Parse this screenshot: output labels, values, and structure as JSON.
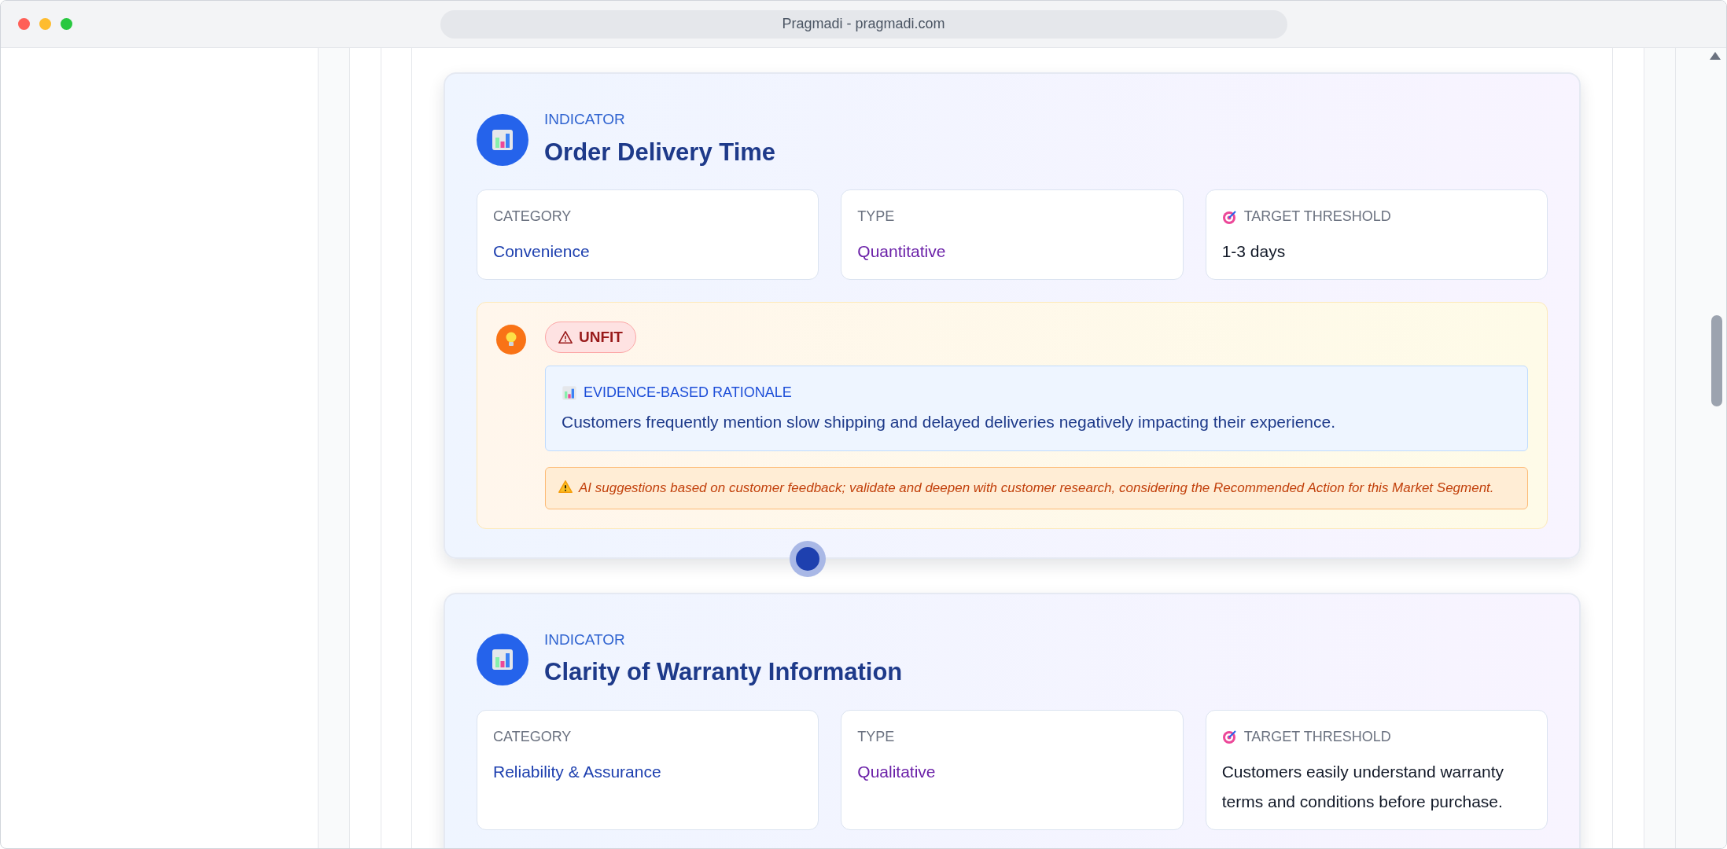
{
  "window": {
    "title": "Pragmadi - pragmadi.com"
  },
  "indicators": [
    {
      "eyebrow": "INDICATOR",
      "title": "Order Delivery Time",
      "fields": [
        {
          "kind": "category",
          "label": "CATEGORY",
          "value": "Convenience"
        },
        {
          "kind": "type",
          "label": "TYPE",
          "value": "Quantitative"
        },
        {
          "kind": "target",
          "label": "TARGET THRESHOLD",
          "value": "1-3 days"
        }
      ],
      "assessment": {
        "verdict": "UNFIT",
        "rationale_label": "EVIDENCE-BASED RATIONALE",
        "rationale": "Customers frequently mention slow shipping and delayed deliveries negatively impacting their experience.",
        "note": "AI suggestions based on customer feedback; validate and deepen with customer research, considering the Recommended Action for this Market Segment."
      }
    },
    {
      "eyebrow": "INDICATOR",
      "title": "Clarity of Warranty Information",
      "fields": [
        {
          "kind": "category",
          "label": "CATEGORY",
          "value": "Reliability & Assurance"
        },
        {
          "kind": "type",
          "label": "TYPE",
          "value": "Qualitative"
        },
        {
          "kind": "target",
          "label": "TARGET THRESHOLD",
          "value": "Customers easily understand warranty terms and conditions before purchase."
        }
      ]
    }
  ]
}
